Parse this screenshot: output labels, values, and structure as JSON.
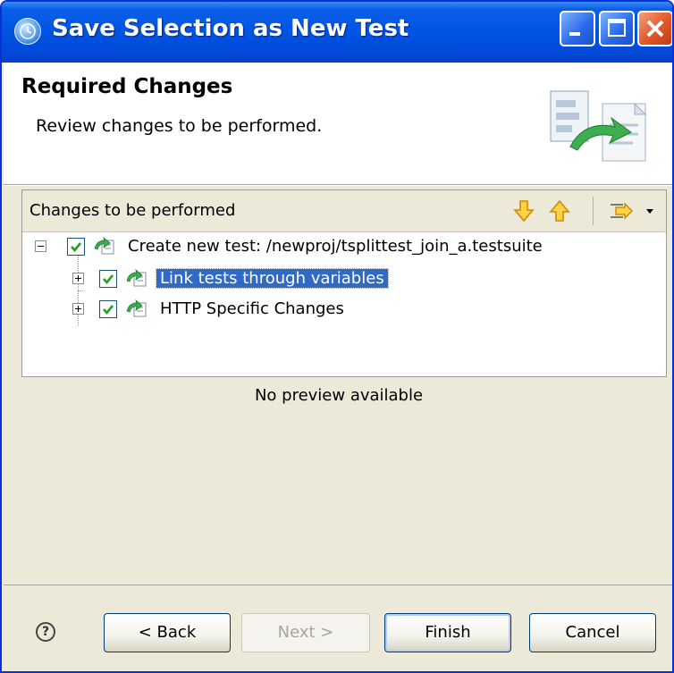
{
  "window": {
    "title": "Save Selection as New Test"
  },
  "header": {
    "title": "Required Changes",
    "description": "Review changes to be performed."
  },
  "changes_panel": {
    "title": "Changes to be performed",
    "tree": [
      {
        "label": "Create new test: /newproj/tsplittest_join_a.testsuite",
        "checked": true,
        "expanded": true
      },
      {
        "label": "Link tests through variables",
        "checked": true,
        "expanded": false,
        "selected": true
      },
      {
        "label": "HTTP Specific Changes",
        "checked": true,
        "expanded": false
      }
    ]
  },
  "preview": {
    "text": "No preview available"
  },
  "buttons": {
    "help_glyph": "?",
    "back": "< Back",
    "next": "Next >",
    "finish": "Finish",
    "cancel": "Cancel"
  },
  "icons": {
    "app": "clock-icon",
    "panel_tools": [
      "arrow-down-icon",
      "arrow-up-icon",
      "filter-icon"
    ],
    "node": "change-node-icon"
  },
  "colors": {
    "titlebar": "#0054e3",
    "selection": "#316ac5",
    "checkbox_check": "#21a121",
    "tool_arrow": "#f5b400"
  }
}
